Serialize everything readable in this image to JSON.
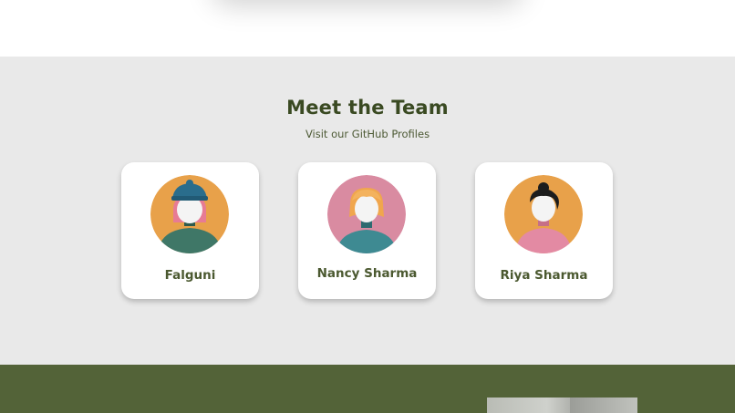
{
  "team": {
    "title": "Meet the Team",
    "subtitle": "Visit our GitHub Profiles",
    "members": [
      {
        "name": "Falguni",
        "avatar_icon": "woman-blue-beanie-avatar-icon",
        "avatar_bg": "#e8a14a"
      },
      {
        "name": "Nancy Sharma",
        "avatar_icon": "woman-blonde-bob-avatar-icon",
        "avatar_bg": "#d98ba1"
      },
      {
        "name": "Riya Sharma",
        "avatar_icon": "woman-black-bun-avatar-icon",
        "avatar_bg": "#e8a14a"
      }
    ]
  },
  "colors": {
    "section_bg": "#e9e9e9",
    "heading": "#3a4a22",
    "footer_bg": "#536338"
  }
}
